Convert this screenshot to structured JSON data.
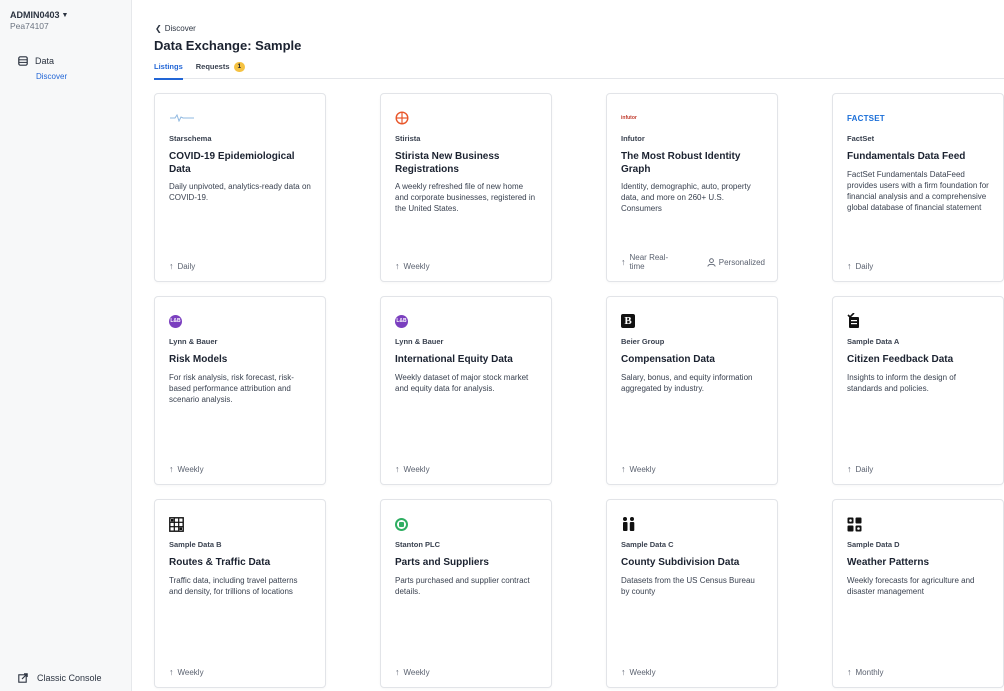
{
  "sidebar": {
    "account_name": "ADMIN0403",
    "account_id": "Pea74107",
    "nav_data": "Data",
    "nav_discover": "Discover",
    "classic_console": "Classic Console"
  },
  "header": {
    "back": "Discover",
    "title": "Data Exchange: Sample"
  },
  "tabs": {
    "listings": "Listings",
    "requests": "Requests",
    "requests_count": "1"
  },
  "colors": {
    "accent": "#2266d6",
    "badge": "#f5c242",
    "lb_logo": "#7b3fbf",
    "stanton_logo": "#2fae62",
    "stirista_logo": "#e8562a",
    "factset_logo": "#1a6ed8"
  },
  "cards": [
    {
      "logo": "starschema-logo",
      "provider": "Starschema",
      "title": "COVID-19 Epidemiological Data",
      "desc": "Daily unpivoted, analytics-ready data on COVID-19.",
      "freq": "Daily"
    },
    {
      "logo": "stirista-logo",
      "provider": "Stirista",
      "title": "Stirista New Business Registrations",
      "desc": "A weekly refreshed file of new home and corporate businesses, registered in the United States.",
      "freq": "Weekly"
    },
    {
      "logo": "infutor-logo",
      "logo_text": "infutor",
      "provider": "Infutor",
      "title": "The Most Robust Identity Graph",
      "desc": "Identity, demographic, auto, property data, and more on 260+ U.S. Consumers",
      "freq": "Near Real-time",
      "extra": "Personalized"
    },
    {
      "logo": "factset-logo",
      "logo_text": "FACTSET",
      "provider": "FactSet",
      "title": "Fundamentals Data Feed",
      "desc": "FactSet Fundamentals DataFeed provides users with a firm foundation for financial analysis and a comprehensive global database of financial statement",
      "freq": "Daily"
    },
    {
      "logo": "lb-logo",
      "logo_text": "L&B",
      "provider": "Lynn & Bauer",
      "title": "Risk Models",
      "desc": "For risk analysis, risk forecast, risk-based performance attribution and scenario analysis.",
      "freq": "Weekly"
    },
    {
      "logo": "lb-logo",
      "logo_text": "L&B",
      "provider": "Lynn & Bauer",
      "title": "International Equity Data",
      "desc": "Weekly dataset of major stock market and equity data for analysis.",
      "freq": "Weekly"
    },
    {
      "logo": "beier-logo",
      "logo_text": "B",
      "provider": "Beier Group",
      "title": "Compensation Data",
      "desc": "Salary, bonus, and equity information aggregated by industry.",
      "freq": "Weekly"
    },
    {
      "logo": "sample-a-logo",
      "provider": "Sample Data A",
      "title": "Citizen Feedback Data",
      "desc": "Insights to inform the design of standards and policies.",
      "freq": "Daily"
    },
    {
      "logo": "sample-b-logo",
      "provider": "Sample Data B",
      "title": "Routes & Traffic Data",
      "desc": "Traffic data, including travel patterns and density, for trillions of locations",
      "freq": "Weekly"
    },
    {
      "logo": "stanton-logo",
      "provider": "Stanton PLC",
      "title": "Parts and Suppliers",
      "desc": "Parts purchased and supplier contract details.",
      "freq": "Weekly"
    },
    {
      "logo": "sample-c-logo",
      "provider": "Sample Data C",
      "title": "County Subdivision Data",
      "desc": "Datasets from the US Census Bureau by county",
      "freq": "Weekly"
    },
    {
      "logo": "sample-d-logo",
      "provider": "Sample Data D",
      "title": "Weather Patterns",
      "desc": "Weekly forecasts for agriculture and disaster management",
      "freq": "Monthly"
    }
  ]
}
